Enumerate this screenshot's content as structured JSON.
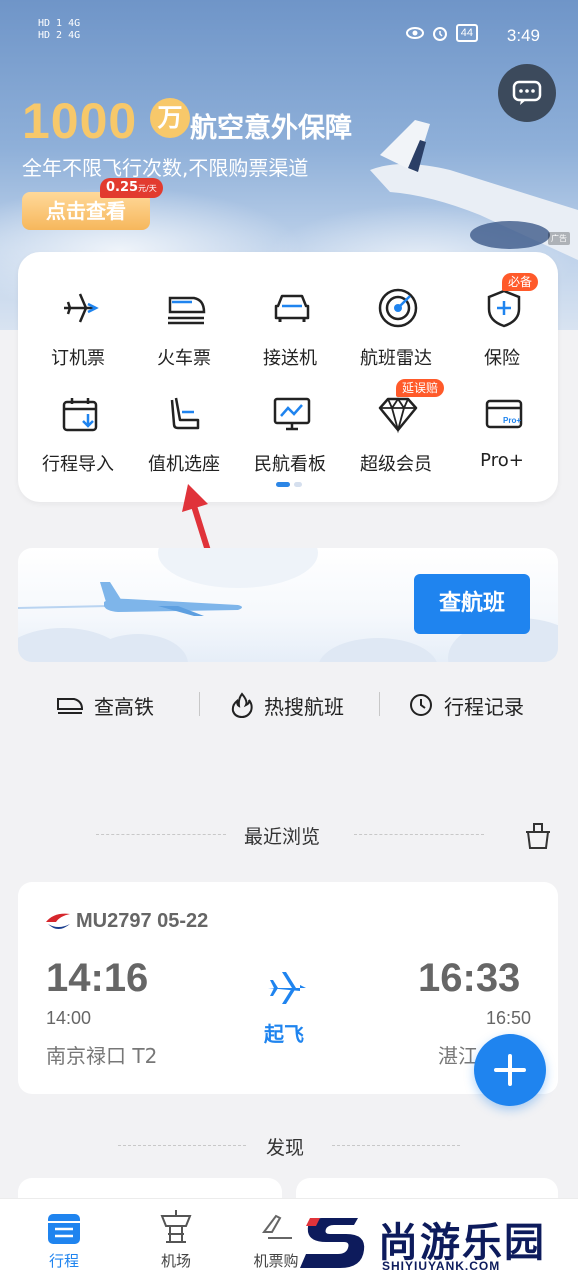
{
  "status_bar": {
    "sim1": "HD 1  4G",
    "sim2": "HD 2  4G",
    "battery": "44",
    "time": "3:49"
  },
  "banner": {
    "amount": "1000",
    "unit": "万",
    "title": "航空意外保障",
    "subtitle": "全年不限飞行次数,不限购票渠道",
    "cta": "点击查看",
    "price": "0.25",
    "price_unit": "元/天",
    "ad": "广告"
  },
  "services": [
    {
      "label": "订机票",
      "icon": "airplane-icon"
    },
    {
      "label": "火车票",
      "icon": "train-icon"
    },
    {
      "label": "接送机",
      "icon": "car-icon"
    },
    {
      "label": "航班雷达",
      "icon": "radar-icon"
    },
    {
      "label": "保险",
      "icon": "shield-icon",
      "badge": "必备"
    },
    {
      "label": "行程导入",
      "icon": "calendar-import-icon"
    },
    {
      "label": "值机选座",
      "icon": "seat-icon"
    },
    {
      "label": "民航看板",
      "icon": "monitor-chart-icon"
    },
    {
      "label": "超级会员",
      "icon": "diamond-icon",
      "badge": "延误赔"
    },
    {
      "label": "Pro+",
      "icon": "pro-card-icon"
    }
  ],
  "search": {
    "button": "查航班"
  },
  "quick_links": [
    {
      "label": "查高铁",
      "icon": "train-outline-icon"
    },
    {
      "label": "热搜航班",
      "icon": "flame-icon"
    },
    {
      "label": "行程记录",
      "icon": "clock-icon"
    }
  ],
  "recent": {
    "title": "最近浏览",
    "flight_no": "MU2797 05-22",
    "dep_time": "14:16",
    "dep_sched": "14:00",
    "dep_airport": "南京禄口 T2",
    "arr_time": "16:33",
    "arr_sched": "16:50",
    "arr_airport": "湛江",
    "status": "起飞"
  },
  "discover": {
    "title": "发现"
  },
  "nav": [
    {
      "label": "行程",
      "icon": "itinerary-icon",
      "active": true
    },
    {
      "label": "机场",
      "icon": "airport-tower-icon",
      "active": false
    },
    {
      "label": "机票购",
      "icon": "ticket-icon",
      "active": false
    }
  ],
  "watermark": {
    "cn": "尚游乐园",
    "en": "SHIYIUYANK.COM"
  },
  "colors": {
    "accent": "#1f84ef",
    "gold": "#f7c86a",
    "badge": "#ff5a2a"
  }
}
